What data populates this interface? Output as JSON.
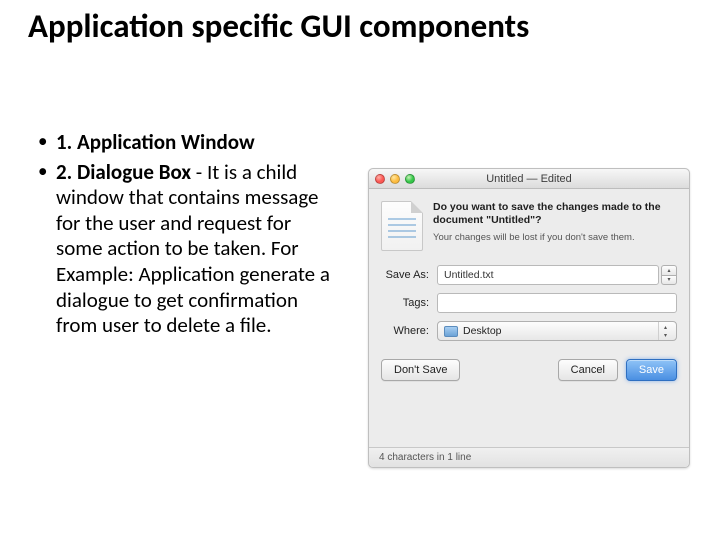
{
  "slide": {
    "title": "Application specific GUI components",
    "bullets": {
      "b1": {
        "label": "1. Application Window"
      },
      "b2": {
        "label": "2. Dialogue Box",
        "body": "- It is a child window that contains message for the user and request for some action to be taken. For Example: Application generate a dialogue to get confirmation from user to delete a file."
      }
    }
  },
  "dialog": {
    "titlebar": "Untitled — Edited",
    "confirm": {
      "heading": "Do you want to save the changes made to the document \"Untitled\"?",
      "sub": "Your changes will be lost if you don't save them."
    },
    "form": {
      "saveas_label": "Save As:",
      "saveas_value": "Untitled.txt",
      "tags_label": "Tags:",
      "tags_value": "",
      "where_label": "Where:",
      "where_value": "Desktop"
    },
    "buttons": {
      "dontsave": "Don't Save",
      "cancel": "Cancel",
      "save": "Save"
    },
    "status": "4 characters in 1 line"
  }
}
